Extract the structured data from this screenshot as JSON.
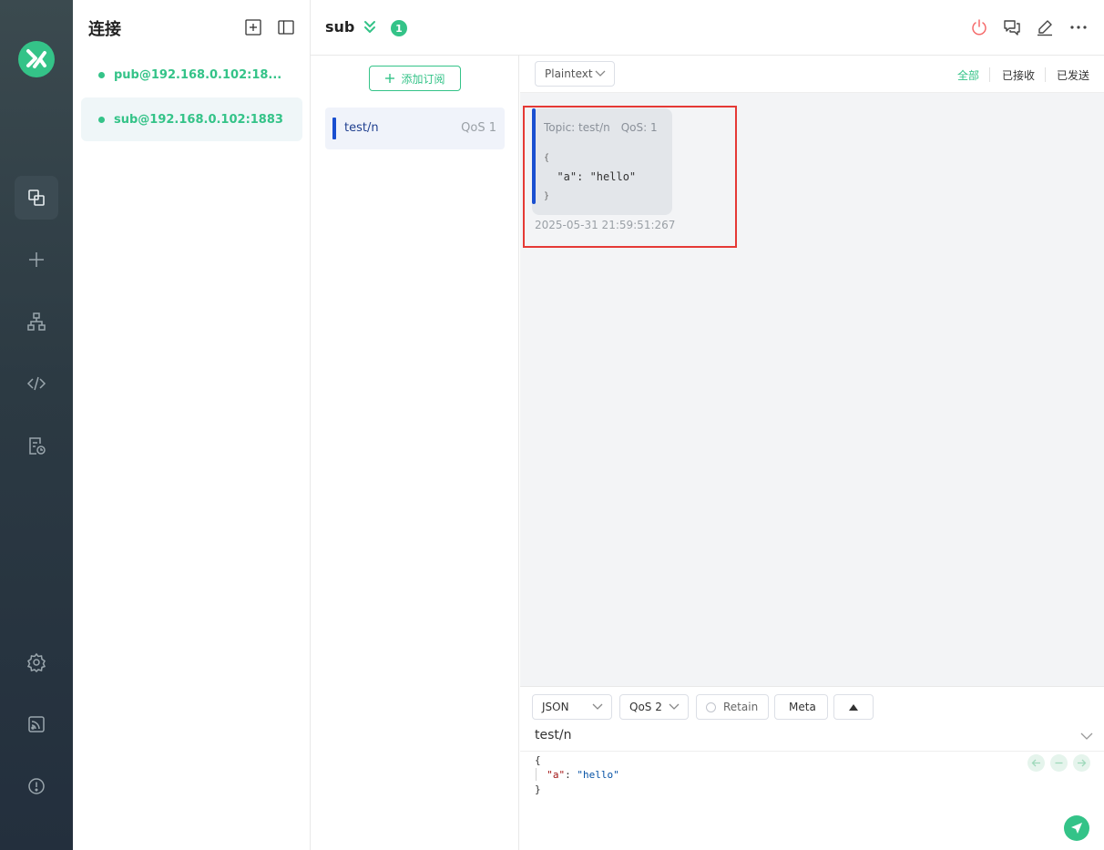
{
  "connections": {
    "title": "连接",
    "items": [
      {
        "name": "pub@192.168.0.102:18...",
        "active": false
      },
      {
        "name": "sub@192.168.0.102:1883",
        "active": true
      }
    ]
  },
  "header": {
    "title": "sub",
    "badge": "1"
  },
  "subscriptions": {
    "add_label": "添加订阅",
    "items": [
      {
        "topic": "test/n",
        "qos": "QoS 1",
        "color": "#1a4fd0"
      }
    ]
  },
  "messages_toolbar": {
    "format": "Plaintext",
    "filters": [
      "全部",
      "已接收",
      "已发送"
    ],
    "active_filter": "全部"
  },
  "messages": [
    {
      "topic": "Topic: test/n",
      "qos": "QoS: 1",
      "payload_lines": [
        "{",
        "  \"a\": \"hello\"",
        "}"
      ],
      "time": "2025-05-31 21:59:51:267"
    }
  ],
  "publish": {
    "format": "JSON",
    "qos": "QoS 2",
    "retain_label": "Retain",
    "meta_label": "Meta",
    "topic": "test/n",
    "payload": {
      "open": "{",
      "key": "\"a\"",
      "sep": ": ",
      "value": "\"hello\"",
      "close": "}"
    }
  },
  "colors": {
    "accent": "#34c388",
    "highlight": "#e53935",
    "topic_bar": "#1a4fd0"
  },
  "icons": {
    "rail": [
      "logo-icon",
      "connections-icon",
      "new-connection-icon",
      "topology-icon",
      "script-icon",
      "log-icon",
      "settings-icon",
      "feed-icon",
      "about-icon"
    ],
    "header": [
      "disconnect-icon",
      "chat-icon",
      "edit-icon",
      "more-icon"
    ]
  }
}
